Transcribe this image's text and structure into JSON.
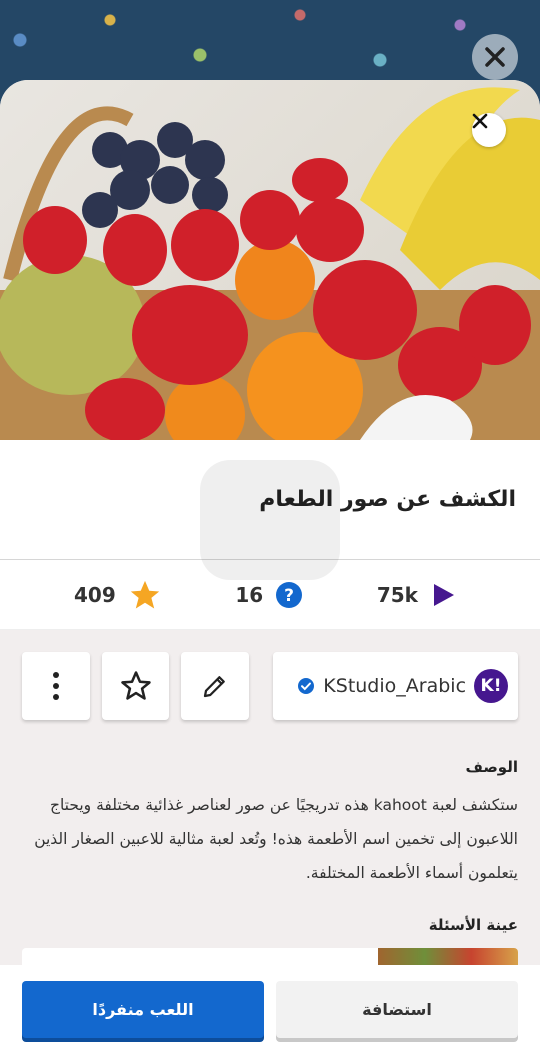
{
  "quiz": {
    "title": "الكشف عن صور الطعام",
    "image_alt": "fruit-basket"
  },
  "stats": {
    "favorites": "409",
    "questions": "16",
    "plays": "75k"
  },
  "creator": {
    "name": "KStudio_Arabic",
    "logo_text": "K!"
  },
  "description": {
    "heading": "الوصف",
    "text": "ستكشف لعبة kahoot هذه تدريجيًا عن صور لعناصر غذائية مختلفة ويحتاج اللاعبون إلى تخمين اسم الأطعمة هذه! وتُعد لعبة مثالية للاعبين الصغار الذين يتعلمون أسماء الأطعمة المختلفة."
  },
  "sample": {
    "heading": "عينة الأسئلة"
  },
  "buttons": {
    "play_solo": "اللعب منفردًا",
    "host": "استضافة"
  },
  "colors": {
    "accent": "#1368ce",
    "kahoot_purple": "#46178f",
    "star": "#f5a623",
    "question": "#1368ce",
    "play": "#46178f"
  }
}
